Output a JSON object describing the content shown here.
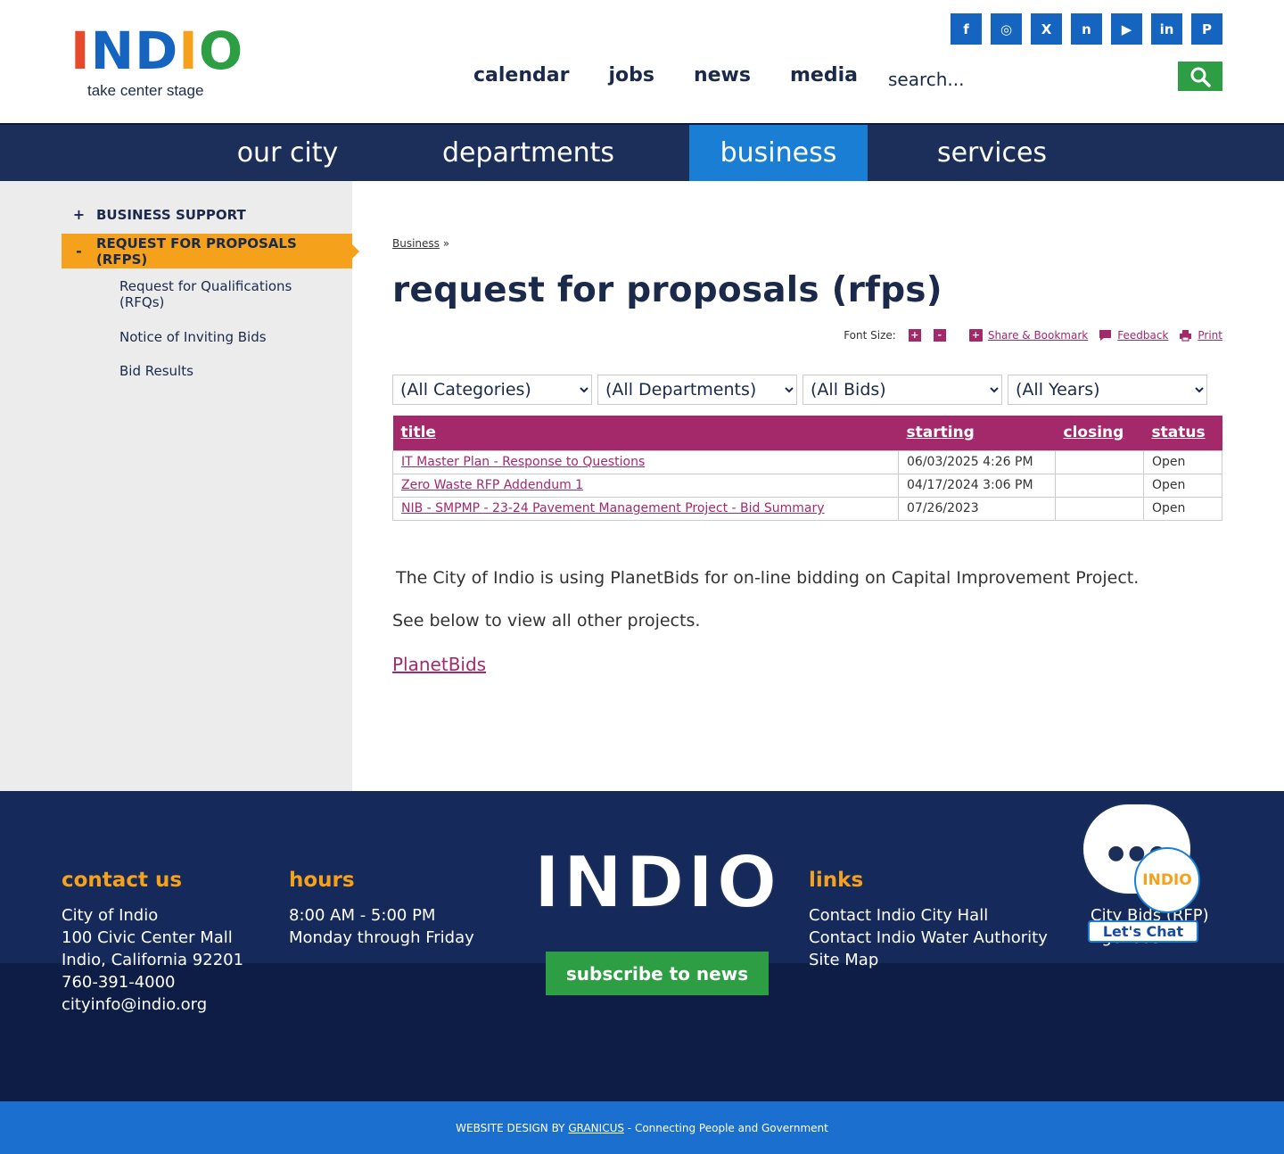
{
  "header": {
    "logo_text": "INDIO",
    "logo_tagline": "take center stage",
    "logo_colors": [
      "#e64a2a",
      "#1565c0",
      "#1565c0",
      "#f5a11b",
      "#2e9e44",
      "#f5a11b"
    ],
    "social": [
      {
        "name": "facebook-icon",
        "glyph": "f"
      },
      {
        "name": "instagram-icon",
        "glyph": "◎"
      },
      {
        "name": "x-icon",
        "glyph": "X"
      },
      {
        "name": "nextdoor-icon",
        "glyph": "n"
      },
      {
        "name": "youtube-icon",
        "glyph": "▶"
      },
      {
        "name": "linkedin-icon",
        "glyph": "in"
      },
      {
        "name": "pinterest-icon",
        "glyph": "P"
      }
    ],
    "topnav": [
      "calendar",
      "jobs",
      "news",
      "media"
    ],
    "search_placeholder": "search..."
  },
  "mainnav": [
    "our city",
    "departments",
    "business",
    "services"
  ],
  "mainnav_active": "business",
  "sidebar": {
    "level1": [
      {
        "label": "BUSINESS SUPPORT",
        "marker": "+"
      },
      {
        "label": "REQUEST FOR PROPOSALS (RFPS)",
        "marker": "-"
      }
    ],
    "level2": [
      "Request for Qualifications (RFQs)",
      "Notice of Inviting Bids",
      "Bid Results"
    ]
  },
  "content": {
    "breadcrumb_link": "Business",
    "breadcrumb_sep": "»",
    "title": "request for proposals (rfps)",
    "tools": {
      "font_size_label": "Font Size:",
      "plus": "+",
      "minus": "-",
      "share": "Share & Bookmark",
      "feedback": "Feedback",
      "print": "Print"
    },
    "filters": [
      "(All Categories)",
      "(All Departments)",
      "(All Bids)",
      "(All Years)"
    ],
    "table": {
      "headers": [
        "title",
        "starting",
        "closing",
        "status"
      ],
      "rows": [
        {
          "title": "IT Master Plan - Response to Questions",
          "starting": "06/03/2025 4:26 PM",
          "closing": "",
          "status": "Open"
        },
        {
          "title": "Zero Waste RFP Addendum 1",
          "starting": "04/17/2024 3:06 PM",
          "closing": "",
          "status": "Open"
        },
        {
          "title": "NIB - SMPMP - 23-24 Pavement Management Project - Bid Summary",
          "starting": "07/26/2023",
          "closing": "",
          "status": "Open"
        }
      ]
    },
    "paragraph1": "The City of Indio is using PlanetBids for on-line bidding on Capital Improvement Project.",
    "paragraph2": "See below to view all other projects.",
    "link": "PlanetBids"
  },
  "footer": {
    "contact": {
      "heading": "contact us",
      "lines": [
        "City of Indio",
        "100 Civic Center Mall",
        "Indio, California 92201",
        "760-391-4000",
        "cityinfo@indio.org"
      ]
    },
    "hours": {
      "heading": "hours",
      "lines": [
        "8:00 AM - 5:00 PM",
        "Monday through Friday"
      ]
    },
    "logo_text": "INDIO",
    "subscribe": "subscribe to news",
    "links": {
      "heading": "links",
      "col1": [
        "Contact Indio City Hall",
        "Contact Indio Water Authority",
        "Site Map"
      ],
      "col2": [
        "City Bids (RFP)",
        "Agendas"
      ]
    },
    "chat": {
      "badge": "INDIO",
      "button": "Let's Chat"
    }
  },
  "bottom": {
    "prefix": "WEBSITE DESIGN BY",
    "link": "GRANICUS",
    "suffix": "- Connecting People and Government"
  }
}
